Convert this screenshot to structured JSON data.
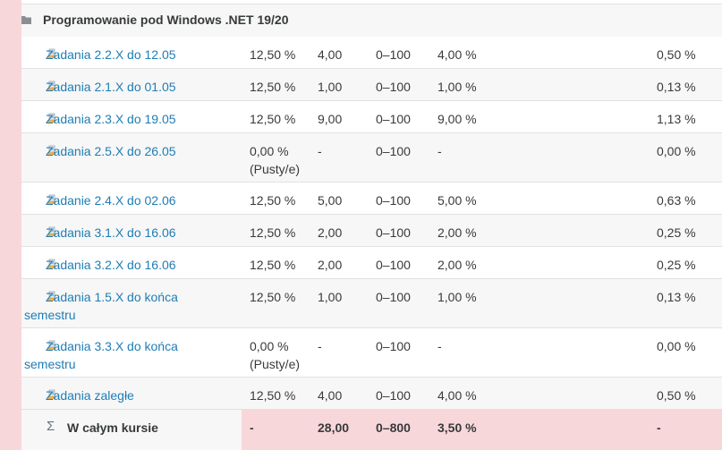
{
  "category": {
    "title": "Programowanie pod Windows .NET 19/20",
    "icon": "folder-icon"
  },
  "items": [
    {
      "name": "Zadania 2.2.X do 12.05",
      "name_cont": "",
      "weight": "12,50 %",
      "weight_note": "",
      "grade": "4,00",
      "range": "0–100",
      "percentage": "4,00 %",
      "contribution": "0,50 %"
    },
    {
      "name": "Zadania 2.1.X do 01.05",
      "name_cont": "",
      "weight": "12,50 %",
      "weight_note": "",
      "grade": "1,00",
      "range": "0–100",
      "percentage": "1,00 %",
      "contribution": "0,13 %"
    },
    {
      "name": "Zadania 2.3.X do 19.05",
      "name_cont": "",
      "weight": "12,50 %",
      "weight_note": "",
      "grade": "9,00",
      "range": "0–100",
      "percentage": "9,00 %",
      "contribution": "1,13 %"
    },
    {
      "name": "Zadania 2.5.X do 26.05",
      "name_cont": "",
      "weight": "0,00 %",
      "weight_note": "(Pusty/e)",
      "grade": "-",
      "range": "0–100",
      "percentage": "-",
      "contribution": "0,00 %"
    },
    {
      "name": "Zadanie 2.4.X do 02.06",
      "name_cont": "",
      "weight": "12,50 %",
      "weight_note": "",
      "grade": "5,00",
      "range": "0–100",
      "percentage": "5,00 %",
      "contribution": "0,63 %"
    },
    {
      "name": "Zadania 3.1.X do 16.06",
      "name_cont": "",
      "weight": "12,50 %",
      "weight_note": "",
      "grade": "2,00",
      "range": "0–100",
      "percentage": "2,00 %",
      "contribution": "0,25 %"
    },
    {
      "name": "Zadania 3.2.X do 16.06",
      "name_cont": "",
      "weight": "12,50 %",
      "weight_note": "",
      "grade": "2,00",
      "range": "0–100",
      "percentage": "2,00 %",
      "contribution": "0,25 %"
    },
    {
      "name": "Zadania 1.5.X do końca",
      "name_cont": "semestru",
      "weight": "12,50 %",
      "weight_note": "",
      "grade": "1,00",
      "range": "0–100",
      "percentage": "1,00 %",
      "contribution": "0,13 %"
    },
    {
      "name": "Zadania 3.3.X do końca",
      "name_cont": "semestru",
      "weight": "0,00 %",
      "weight_note": "(Pusty/e)",
      "grade": "-",
      "range": "0–100",
      "percentage": "-",
      "contribution": "0,00 %"
    },
    {
      "name": "Zadania zaległe",
      "name_cont": "",
      "weight": "12,50 %",
      "weight_note": "",
      "grade": "4,00",
      "range": "0–100",
      "percentage": "4,00 %",
      "contribution": "0,50 %"
    }
  ],
  "total": {
    "symbol": "Σ",
    "label": "W całym kursie",
    "weight": "-",
    "grade": "28,00",
    "range": "0–800",
    "percentage": "3,50 %",
    "contribution": "-"
  },
  "colors": {
    "link": "#1f7db5",
    "total_highlight": "#f8d7da",
    "row_alt": "#f7f7f7"
  }
}
